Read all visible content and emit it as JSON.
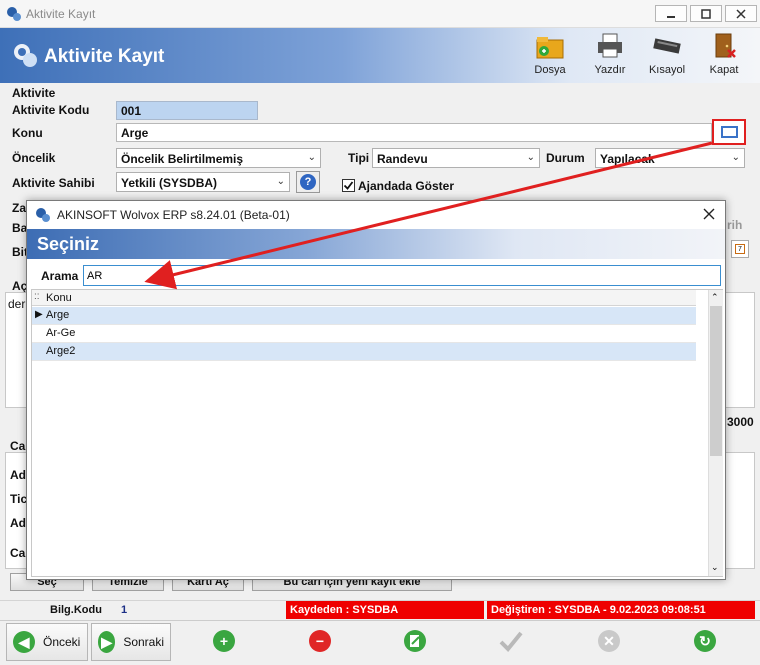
{
  "window": {
    "title": "Aktivite Kayıt",
    "header_title": "Aktivite Kayıt"
  },
  "toolbar": [
    {
      "label": "Dosya",
      "icon": "folder-icon"
    },
    {
      "label": "Yazdır",
      "icon": "printer-icon"
    },
    {
      "label": "Kısayol",
      "icon": "keyboard-icon"
    },
    {
      "label": "Kapat",
      "icon": "exit-door-icon"
    }
  ],
  "form": {
    "group_label": "Aktivite",
    "code_label": "Aktivite Kodu",
    "code_value": "001",
    "subject_label": "Konu",
    "subject_value": "Arge",
    "priority_label": "Öncelik",
    "priority_value": "Öncelik Belirtilmemiş",
    "type_label": "Tipi",
    "type_value": "Randevu",
    "status_label": "Durum",
    "status_value": "Yapılacak",
    "owner_label": "Aktivite Sahibi",
    "owner_value": "Yetkili  (SYSDBA)",
    "agenda_label": "Ajandada Göster",
    "agenda_checked": true
  },
  "behind": {
    "za": "Za",
    "ba": "Ba",
    "bit": "Bit",
    "ac": "Aç",
    "der": "der",
    "rih": "rih",
    "num3000": "3000",
    "car": "Car",
    "ad1": "Ad",
    "tic": "Tic",
    "ad2": "Ad",
    "car2": "Car",
    "btn_sec": "Seç",
    "btn_temizle": "Temizle",
    "btn_kartiac": "Kartı Aç",
    "btn_yeni": "Bu cari için yeni kayıt ekle"
  },
  "statusbar": {
    "bilg_label": "Bilg.Kodu",
    "bilg_value": "1",
    "saved_by": "Kaydeden : SYSDBA",
    "changed_by": "Değiştiren : SYSDBA - 9.02.2023 09:08:51"
  },
  "nav": {
    "prev": "Önceki",
    "next": "Sonraki"
  },
  "dialog": {
    "title": "AKINSOFT Wolvox ERP s8.24.01 (Beta-01)",
    "header": "Seçiniz",
    "search_label": "Arama",
    "search_value": "AR",
    "column_header": "Konu",
    "rows": [
      "Arge",
      "Ar-Ge",
      "Arge2"
    ]
  },
  "colors": {
    "accent_blue": "#3e70b8",
    "status_red": "#ef0000",
    "annotation_red": "#e02020",
    "selected_row": "#d7e6f7"
  }
}
